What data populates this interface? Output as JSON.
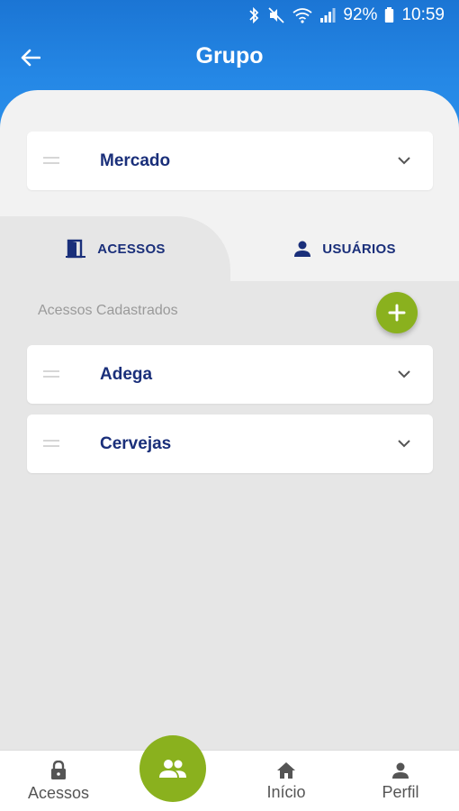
{
  "status_bar": {
    "battery": "92%",
    "time": "10:59"
  },
  "header": {
    "title": "Grupo"
  },
  "group_select": {
    "value": "Mercado"
  },
  "tabs": [
    {
      "label": "ACESSOS",
      "icon": "door-icon",
      "active": true
    },
    {
      "label": "USUÁRIOS",
      "icon": "person-icon",
      "active": false
    }
  ],
  "section": {
    "label": "Acessos Cadastrados"
  },
  "accesses": [
    {
      "label": "Adega"
    },
    {
      "label": "Cervejas"
    }
  ],
  "bottom_nav": {
    "items": [
      {
        "label": "Acessos",
        "icon": "lock-icon"
      },
      {
        "label": "Grupo",
        "icon": "group-icon",
        "active": true
      },
      {
        "label": "Início",
        "icon": "home-icon"
      },
      {
        "label": "Perfil",
        "icon": "person-icon"
      }
    ]
  },
  "colors": {
    "primary": "#2588e6",
    "accent": "#8ab11e",
    "text_dark": "#1a2f7a"
  }
}
